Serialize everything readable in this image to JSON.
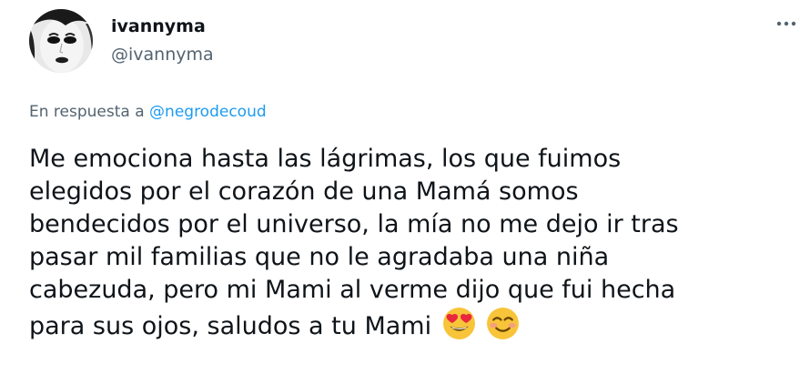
{
  "author": {
    "display_name": "ivannyma",
    "handle": "@ivannyma",
    "avatar_icon": "profile-avatar"
  },
  "more_icon": "more-horizontal-icon",
  "reply": {
    "prefix": "En respuesta a",
    "mention": "@negrodecoud"
  },
  "tweet": {
    "lines": [
      "Me emociona hasta las lágrimas, los que fuimos",
      "elegidos por el corazón de una Mamá somos",
      "bendecidos por el universo, la mía no me dejo ir tras",
      "pasar mil familias que no le agradaba una niña",
      "cabezuda, pero mi Mami al verme dijo que fui hecha",
      "para sus ojos, saludos a tu Mami"
    ],
    "emojis": [
      "heart-eyes-emoji",
      "smiling-face-emoji"
    ]
  },
  "colors": {
    "text": "#0f1419",
    "secondary": "#536471",
    "link": "#1d9bf0",
    "emoji_yellow": "#f7c43a",
    "emoji_heart": "#e8283c"
  }
}
